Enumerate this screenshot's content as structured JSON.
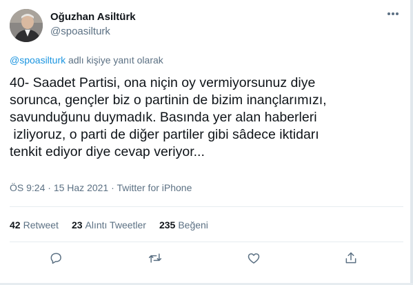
{
  "author": {
    "name": "Oğuzhan Asiltürk",
    "handle": "@spoasilturk"
  },
  "reply_context": {
    "mention": "@spoasilturk",
    "suffix": " adlı kişiye yanıt olarak"
  },
  "tweet": {
    "text": "40- Saadet Partisi, ona niçin oy vermiyorsunuz diye\nsorunca, gençler biz o partinin de bizim inançlarımızı,\nsavunduğunu duymadık. Basında yer alan haberleri\n izliyoruz, o parti de diğer partiler gibi sâdece iktidarı\ntenkit ediyor diye cevap veriyor...",
    "time": "ÖS 9:24",
    "separator": " · ",
    "date": "15 Haz 2021",
    "source": "Twitter for iPhone"
  },
  "stats": {
    "retweets_count": "42",
    "retweets_label": "Retweet",
    "quotes_count": "23",
    "quotes_label": "Alıntı Tweetler",
    "likes_count": "235",
    "likes_label": "Beğeni"
  },
  "icons": {
    "reply": "speech-bubble-icon",
    "retweet": "retweet-icon",
    "like": "heart-icon",
    "share": "share-icon",
    "more": "more-dots-icon"
  },
  "colors": {
    "accent": "#1b95e0",
    "text": "#0f1419",
    "secondary": "#5b7083",
    "divider": "#e6ecf0"
  }
}
